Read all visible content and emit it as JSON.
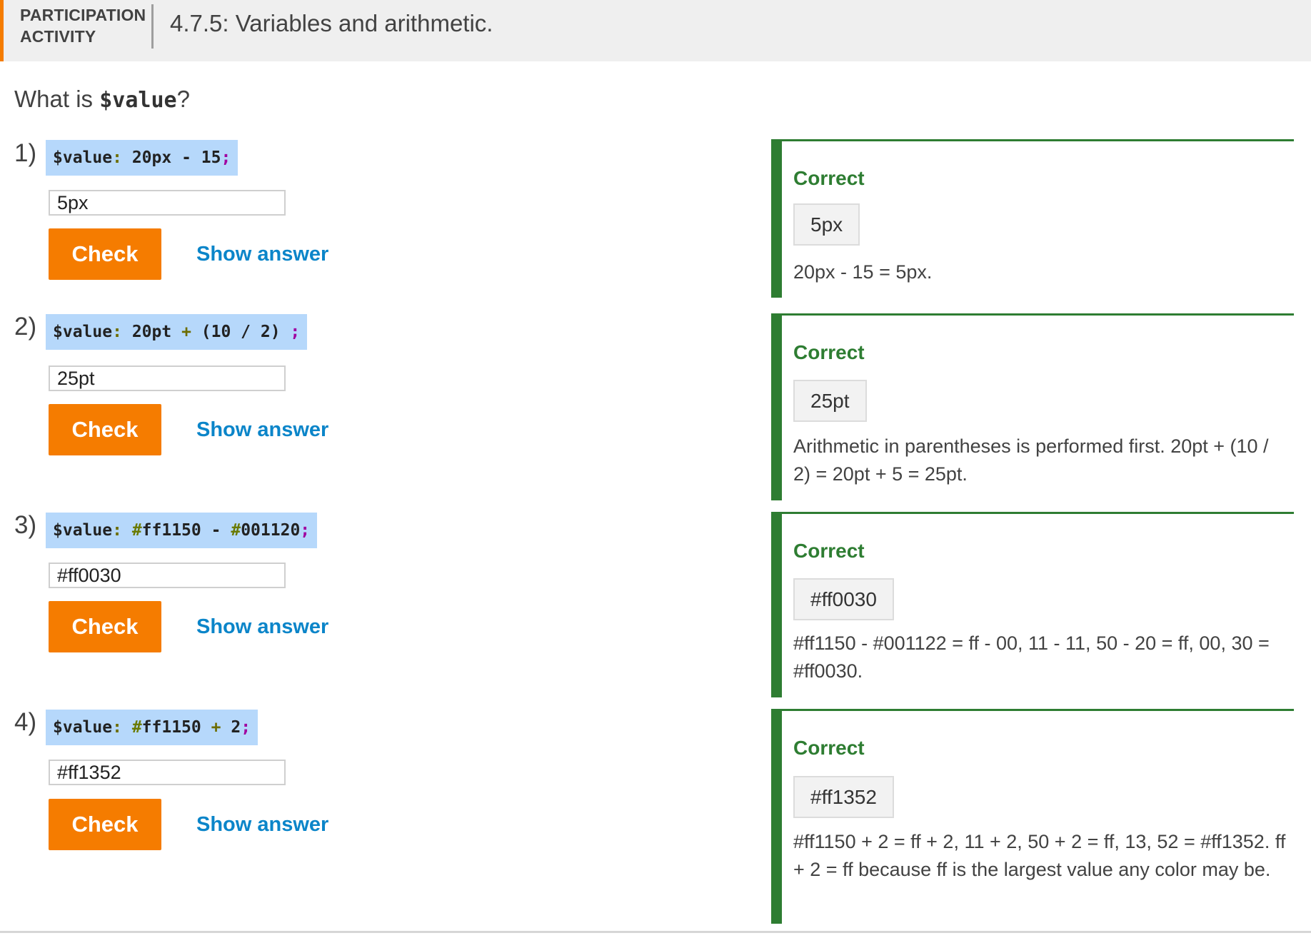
{
  "header": {
    "kind": "PARTICIPATION ACTIVITY",
    "title": "4.7.5: Variables and arithmetic."
  },
  "prompt": {
    "text": "What is ",
    "code": "$value",
    "suffix": "?"
  },
  "colors": {
    "accent": "#f57c00",
    "correct": "#2e7d32",
    "link": "#0b85c9",
    "code_bg": "#b6d8fb"
  },
  "questions": [
    {
      "number": "1)",
      "code": {
        "var": "$value",
        "colon": ":",
        "a": "20px",
        "op": "-",
        "b": "15",
        "semi": ";"
      },
      "answer": "5px",
      "check_label": "Check",
      "show_label": "Show answer",
      "feedback": {
        "status": "Correct",
        "chip": "5px",
        "explanation": "20px - 15 = 5px."
      }
    },
    {
      "number": "2)",
      "code": {
        "var": "$value",
        "colon": ":",
        "a": "20pt",
        "op": "+",
        "b": "(10 / 2)",
        "semi": ";"
      },
      "answer": "25pt",
      "check_label": "Check",
      "show_label": "Show answer",
      "feedback": {
        "status": "Correct",
        "chip": "25pt",
        "explanation": "Arithmetic in parentheses is performed first. 20pt + (10 / 2) = 20pt + 5 = 25pt."
      }
    },
    {
      "number": "3)",
      "code": {
        "var": "$value",
        "colon": ":",
        "a_hash": "#",
        "a": "ff1150",
        "op": "-",
        "b_hash": "#",
        "b": "001120",
        "semi": ";"
      },
      "answer": "#ff0030",
      "check_label": "Check",
      "show_label": "Show answer",
      "feedback": {
        "status": "Correct",
        "chip": "#ff0030",
        "explanation": "#ff1150 - #001122 = ff - 00, 11 - 11, 50 - 20 = ff, 00, 30 = #ff0030."
      }
    },
    {
      "number": "4)",
      "code": {
        "var": "$value",
        "colon": ":",
        "a_hash": "#",
        "a": "ff1150",
        "op": "+",
        "b": "2",
        "semi": ";"
      },
      "answer": "#ff1352",
      "check_label": "Check",
      "show_label": "Show answer",
      "feedback": {
        "status": "Correct",
        "chip": "#ff1352",
        "explanation": "#ff1150 + 2 = ff + 2, 11 + 2, 50 + 2 = ff, 13, 52 = #ff1352. ff + 2 = ff because ff is the largest value any color may be."
      }
    }
  ]
}
